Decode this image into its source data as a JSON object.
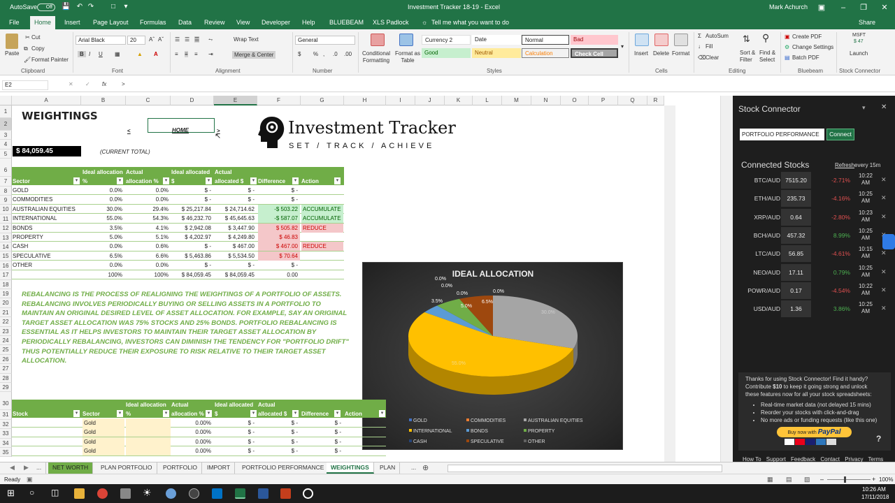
{
  "app": {
    "autosave_label": "AutoSave",
    "autosave_state": "Off",
    "window_title": "Investment Tracker 18-19  -  Excel",
    "user": "Mark Achurch"
  },
  "menu": {
    "tabs": [
      "File",
      "Home",
      "Insert",
      "Page Layout",
      "Formulas",
      "Data",
      "Review",
      "View",
      "Developer",
      "Help",
      "BLUEBEAM",
      "XLS Padlock"
    ],
    "tell_me": "Tell me what you want to do",
    "share": "Share"
  },
  "ribbon": {
    "paste": "Paste",
    "cut": "Cut",
    "copy": "Copy",
    "format_painter": "Format Painter",
    "clipboard": "Clipboard",
    "font_name": "Arial Black",
    "font_size": "20",
    "font": "Font",
    "wrap_text": "Wrap Text",
    "merge_center": "Merge & Center",
    "alignment": "Alignment",
    "number_format": "General",
    "number": "Number",
    "cond_fmt": "Conditional\nFormatting",
    "format_table": "Format as\nTable",
    "styles_label": "Styles",
    "styles": [
      "Currency 2",
      "Date",
      "Normal",
      "Bad",
      "Good",
      "Neutral",
      "Calculation",
      "Check Cell"
    ],
    "insert": "Insert",
    "delete": "Delete",
    "format": "Format",
    "cells": "Cells",
    "autosum": "AutoSum",
    "fill": "Fill",
    "clear": "Clear",
    "sort_filter": "Sort &\nFilter",
    "find_select": "Find &\nSelect",
    "editing": "Editing",
    "create_pdf": "Create PDF",
    "change_settings": "Change Settings",
    "batch_pdf": "Batch PDF",
    "bluebeam": "Bluebeam",
    "msft": "MSFT",
    "msft_price": "$ 47",
    "launch": "Launch",
    "stock_connector": "Stock Connector"
  },
  "formula_bar": {
    "name_box": "E2",
    "content": ">"
  },
  "columns": [
    "A",
    "B",
    "C",
    "D",
    "E",
    "F",
    "G",
    "H",
    "I",
    "J",
    "K",
    "L",
    "M",
    "N",
    "O",
    "P",
    "Q",
    "R"
  ],
  "rows": [
    "1",
    "2",
    "3",
    "4",
    "5",
    "6",
    "7",
    "8",
    "9",
    "10",
    "11",
    "12",
    "13",
    "14",
    "15",
    "16",
    "17",
    "18",
    "19",
    "20",
    "21",
    "22",
    "23",
    "24",
    "25",
    "26",
    "27",
    "28",
    "29",
    "30",
    "31",
    "32",
    "33",
    "34",
    "35"
  ],
  "sheet": {
    "weightings": "WEIGHTINGS",
    "nav_left": "<",
    "home": "HOME",
    "nav_right": ">",
    "total": "$   84,059.45",
    "current_total": "(CURRENT TOTAL)",
    "brand": "Investment Tracker",
    "tagline": "SET / TRACK / ACHIEVE",
    "table_headers": [
      "Sector",
      "Ideal allocation %",
      "Actual allocation %",
      "Ideal allocated $",
      "Actual allocated $",
      "Difference",
      "Action"
    ],
    "rows": [
      [
        "GOLD",
        "0.0%",
        "0.0%",
        "$          -",
        "$          -",
        "$          -",
        ""
      ],
      [
        "COMMODITIES",
        "0.0%",
        "0.0%",
        "$          -",
        "$          -",
        "$          -",
        ""
      ],
      [
        "AUSTRALIAN EQUITIES",
        "30.0%",
        "29.4%",
        "$  25,217.84",
        "$  24,714.62",
        "-$     503.22",
        "ACCUMULATE"
      ],
      [
        "INTERNATIONAL",
        "55.0%",
        "54.3%",
        "$  46,232.70",
        "$  45,645.63",
        "-$     587.07",
        "ACCUMULATE"
      ],
      [
        "BONDS",
        "3.5%",
        "4.1%",
        "$   2,942.08",
        "$   3,447.90",
        "$     505.82",
        "REDUCE"
      ],
      [
        "PROPERTY",
        "5.0%",
        "5.1%",
        "$   4,202.97",
        "$   4,249.80",
        "$      46.83",
        ""
      ],
      [
        "CASH",
        "0.0%",
        "0.6%",
        "$          -",
        "$     467.00",
        "$     467.00",
        "REDUCE"
      ],
      [
        "SPECULATIVE",
        "6.5%",
        "6.6%",
        "$   5,463.86",
        "$   5,534.50",
        "$      70.64",
        ""
      ],
      [
        "OTHER",
        "0.0%",
        "0.0%",
        "$          -",
        "$          -",
        "$          -",
        ""
      ],
      [
        "",
        "100%",
        "100%",
        "$  84,059.45",
        "$  84,059.45",
        "0.00",
        ""
      ]
    ],
    "rebalancing": "REBALANCING IS THE PROCESS OF REALIGNING THE WEIGHTINGS OF A PORTFOLIO OF ASSETS. REBALANCING INVOLVES PERIODICALLY BUYING OR SELLING ASSETS IN A PORTFOLIO TO MAINTAIN AN ORIGINAL DESIRED LEVEL OF ASSET ALLOCATION. FOR EXAMPLE, SAY AN ORIGINAL TARGET ASSET ALLOCATION WAS 75% STOCKS AND 25% BONDS. PORTFOLIO REBALANCING IS ESSENTIAL AS IT HELPS INVESTORS TO MAINTAIN THEIR TARGET ASSET ALLOCATION BY PERIODICALLY REBALANCING, INVESTORS CAN DIMINISH THE TENDENCY FOR \"PORTFOLIO DRIFT\" THUS POTENTIALLY REDUCE THEIR EXPOSURE TO RISK RELATIVE TO THEIR TARGET ASSET ALLOCATION.",
    "stock_headers": [
      "Stock",
      "Sector",
      "Ideal allocation %",
      "Actual allocation %",
      "Ideal allocated $",
      "Actual allocated $",
      "Difference",
      "Action"
    ],
    "stock_rows": [
      [
        "",
        "Gold",
        "",
        "0.00%",
        "$          -",
        "$          -",
        "$          -",
        ""
      ],
      [
        "",
        "Gold",
        "",
        "0.00%",
        "$          -",
        "$          -",
        "$          -",
        ""
      ],
      [
        "",
        "Gold",
        "",
        "0.00%",
        "$          -",
        "$          -",
        "$          -",
        ""
      ],
      [
        "",
        "Gold",
        "",
        "0.00%",
        "$          -",
        "$          -",
        "$          -",
        ""
      ]
    ]
  },
  "chart_data": {
    "type": "pie",
    "title": "IDEAL ALLOCATION",
    "categories": [
      "GOLD",
      "COMMODITIES",
      "AUSTRALIAN EQUITIES",
      "INTERNATIONAL",
      "BONDS",
      "PROPERTY",
      "CASH",
      "SPECULATIVE",
      "OTHER"
    ],
    "values": [
      0.0,
      0.0,
      30.0,
      55.0,
      3.5,
      5.0,
      0.0,
      6.5,
      0.0
    ],
    "labels": [
      "0.0%",
      "0.0%",
      "30.0%",
      "55.0%",
      "3.5%",
      "5.0%",
      "0.0%",
      "6.5%",
      "0.0%"
    ],
    "colors": [
      "#4472c4",
      "#ed7d31",
      "#a5a5a5",
      "#ffc000",
      "#5b9bd5",
      "#70ad47",
      "#264478",
      "#9e480e",
      "#636363"
    ],
    "legend": "bottom"
  },
  "pane": {
    "title": "Stock Connector",
    "input": "PORTFOLIO PERFORMANCE",
    "connect": "Connect",
    "connected": "Connected Stocks",
    "refresh": "Refresh",
    "refresh_every": "every 15m",
    "stocks": [
      {
        "sym": "BTC/AUD",
        "price": "7515.20",
        "chg": "-2.71%",
        "up": false,
        "time": "10:22\nAM"
      },
      {
        "sym": "ETH/AUD",
        "price": "235.73",
        "chg": "-4.16%",
        "up": false,
        "time": "10:25\nAM"
      },
      {
        "sym": "XRP/AUD",
        "price": "0.64",
        "chg": "-2.80%",
        "up": false,
        "time": "10:23\nAM"
      },
      {
        "sym": "BCH/AUD",
        "price": "457.32",
        "chg": "8.99%",
        "up": true,
        "time": "10:25\nAM"
      },
      {
        "sym": "LTC/AUD",
        "price": "56.85",
        "chg": "-4.61%",
        "up": false,
        "time": "10:15\nAM"
      },
      {
        "sym": "NEO/AUD",
        "price": "17.11",
        "chg": "0.79%",
        "up": true,
        "time": "10:25\nAM"
      },
      {
        "sym": "POWR/AUD",
        "price": "0.17",
        "chg": "-4.54%",
        "up": false,
        "time": "10:22\nAM"
      },
      {
        "sym": "USD/AUD",
        "price": "1.36",
        "chg": "3.86%",
        "up": true,
        "time": "10:25\nAM"
      }
    ],
    "promo_1": "Thanks for using Stock Connector! Find it handy?",
    "promo_2a": "Contribute ",
    "promo_amount": "$10",
    "promo_2b": " to keep it going strong and unlock",
    "promo_3": "these features now for all your stock spreadsheets:",
    "features": [
      "Real-time market data (not delayed 15 mins)",
      "Reorder your stocks with click-and-drag",
      "No more ads or funding requests (like this one)"
    ],
    "paypal_pre": "Buy now with",
    "paypal": "PayPal",
    "help": "?",
    "links": [
      "How To",
      "Support",
      "Feedback",
      "Contact",
      "Privacy",
      "Terms"
    ]
  },
  "sheet_tabs": [
    "...",
    "NET WORTH",
    "PLAN PORTFOLIO",
    "PORTFOLIO",
    "IMPORT",
    "PORTFOLIO PERFORMANCE",
    "WEIGHTINGS",
    "PLAN",
    "..."
  ],
  "status": {
    "ready": "Ready",
    "zoom": "100%"
  },
  "clock": {
    "time": "10:26 AM",
    "date": "17/11/2018"
  }
}
